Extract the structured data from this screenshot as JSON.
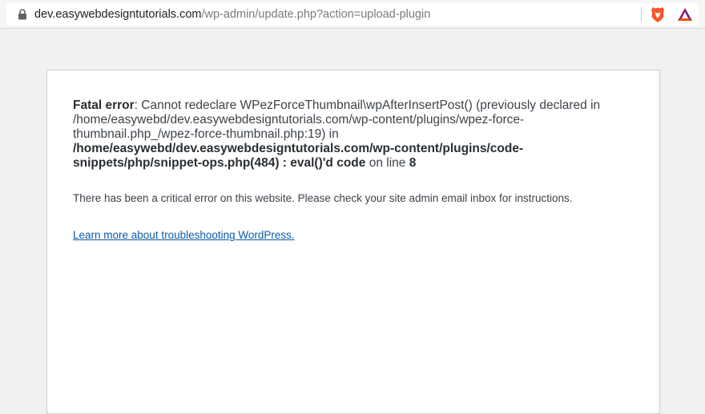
{
  "browser": {
    "url_host": "dev.easywebdesigntutorials.com",
    "url_path": "/wp-admin/update.php?action=upload-plugin",
    "icons": [
      "lock-icon",
      "brave-shield-icon",
      "bat-rewards-icon"
    ]
  },
  "error": {
    "label": "Fatal error",
    "message_part1": ": Cannot redeclare WPezForceThumbnail\\wpAfterInsertPost() (previously declared in /home/easywebd/dev.easywebdesigntutorials.com/wp-content/plugins/wpez-force-thumbnail.php_/wpez-force-thumbnail.php:19) in ",
    "file_path": "/home/easywebd/dev.easywebdesigntutorials.com/wp-content/plugins/code-snippets/php/snippet-ops.php(484) : eval()'d code",
    "line_text": " on line ",
    "line_number": "8"
  },
  "critical_message": "There has been a critical error on this website. Please check your site admin email inbox for instructions.",
  "learn_more_link": "Learn more about troubleshooting WordPress.",
  "colors": {
    "page_background": "#f1f1f1",
    "link": "#0a5aa6",
    "text": "#3c434a",
    "brave_orange": "#fb542b",
    "bat_purple": "#662d91"
  }
}
